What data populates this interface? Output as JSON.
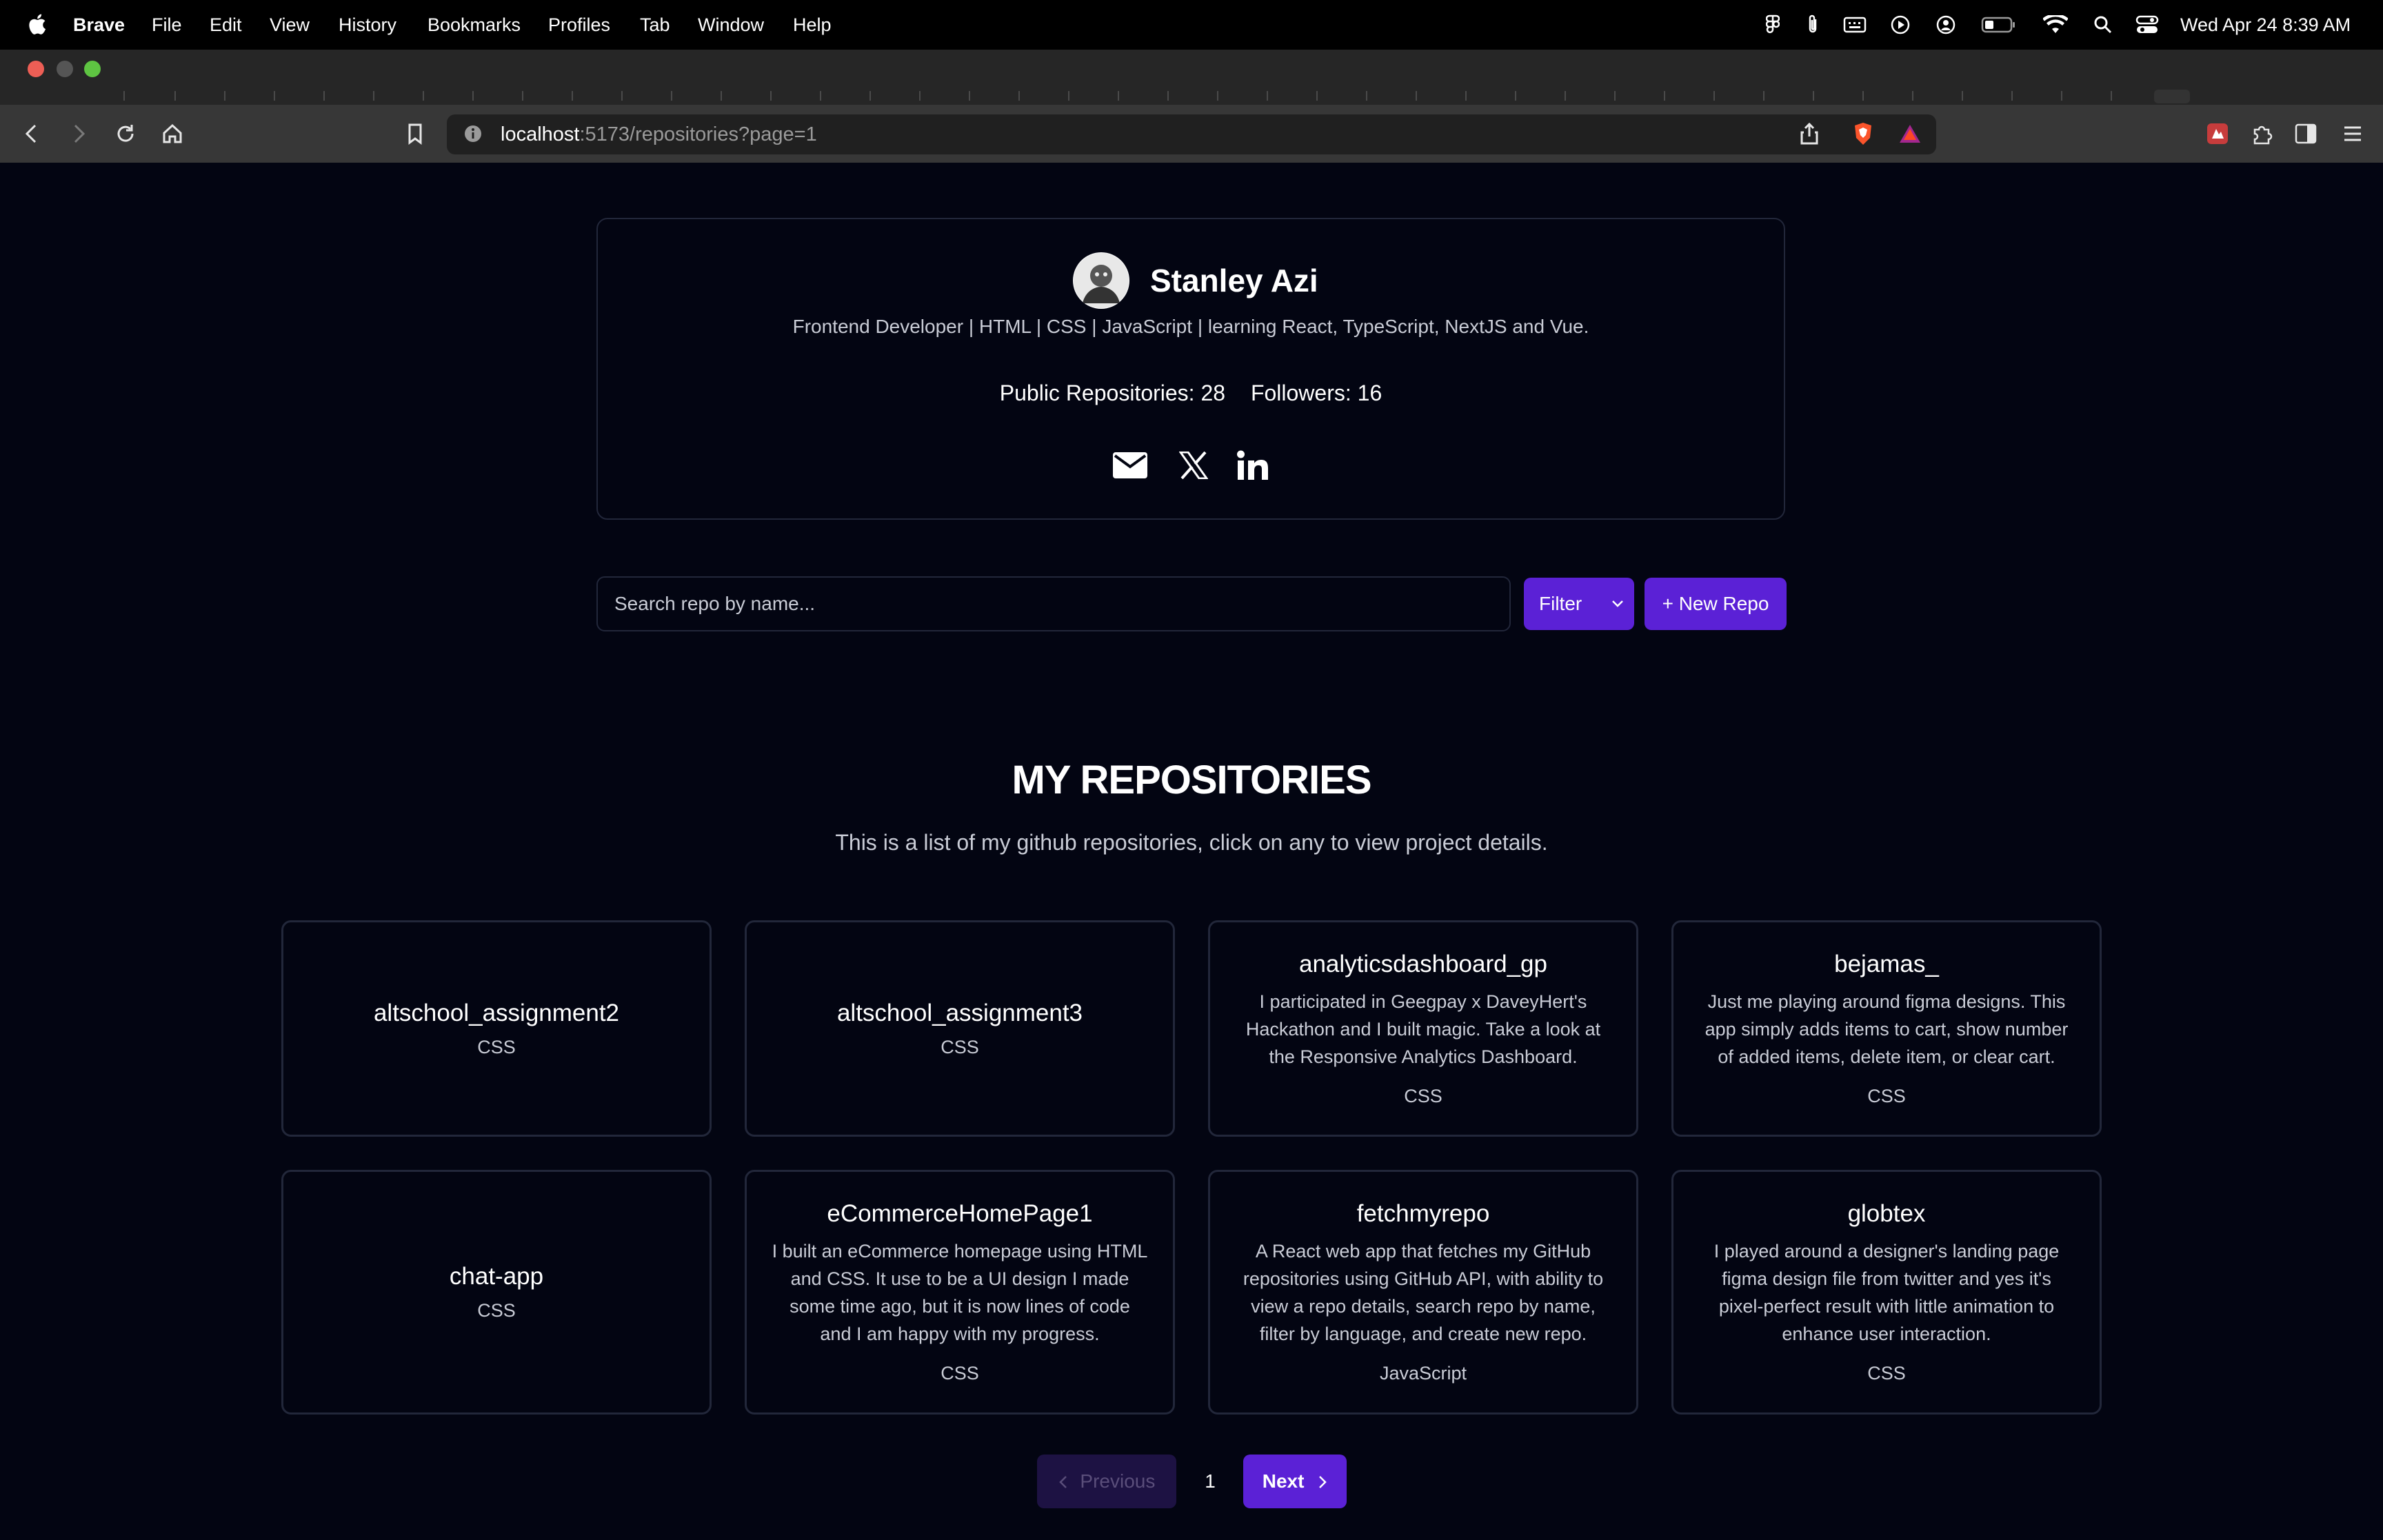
{
  "menubar": {
    "app": "Brave",
    "items": [
      "File",
      "Edit",
      "View",
      "History",
      "Bookmarks",
      "Profiles",
      "Tab",
      "Window",
      "Help"
    ],
    "clock": "Wed Apr 24  8:39 AM"
  },
  "browser": {
    "url_host": "localhost",
    "url_rest": ":5173/repositories?page=1"
  },
  "profile": {
    "name": "Stanley Azi",
    "bio": "Frontend Developer | HTML | CSS | JavaScript | learning React, TypeScript, NextJS and Vue.",
    "public_repos": "Public Repositories: 28",
    "followers": "Followers: 16"
  },
  "search": {
    "placeholder": "Search repo by name...",
    "filter_label": "Filter",
    "new_repo_label": "+ New Repo"
  },
  "section": {
    "title": "MY REPOSITORIES",
    "subtitle": "This is a list of my github repositories, click on any to view project details."
  },
  "repos": [
    {
      "name": "altschool_assignment2",
      "desc": "",
      "lang": "CSS"
    },
    {
      "name": "altschool_assignment3",
      "desc": "",
      "lang": "CSS"
    },
    {
      "name": "analyticsdashboard_gp",
      "desc": "I participated in Geegpay x DaveyHert's Hackathon and I built magic. Take a look at the Responsive Analytics Dashboard.",
      "lang": "CSS"
    },
    {
      "name": "bejamas_",
      "desc": "Just me playing around figma designs. This app simply adds items to cart, show number of added items, delete item, or clear cart.",
      "lang": "CSS"
    },
    {
      "name": "chat-app",
      "desc": "",
      "lang": "CSS"
    },
    {
      "name": "eCommerceHomePage1",
      "desc": "I built an eCommerce homepage using HTML and CSS. It use to be a UI design I made some time ago, but it is now lines of code and I am happy with my progress.",
      "lang": "CSS"
    },
    {
      "name": "fetchmyrepo",
      "desc": "A React web app that fetches my GitHub repositories using GitHub API, with ability to view a repo details, search repo by name, filter by language, and create new repo.",
      "lang": "JavaScript"
    },
    {
      "name": "globtex",
      "desc": "I played around a designer's landing page figma design file from twitter and yes it's pixel-perfect result with little animation to enhance user interaction.",
      "lang": "CSS"
    }
  ],
  "pagination": {
    "prev_label": "Previous",
    "current_page": "1",
    "next_label": "Next"
  }
}
